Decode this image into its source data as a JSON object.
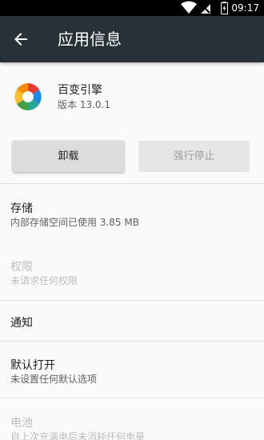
{
  "status_bar": {
    "time": "09:17",
    "icons": [
      "wifi-icon",
      "no-sim-icon",
      "battery-charging-icon"
    ]
  },
  "toolbar": {
    "title": "应用信息",
    "back_icon": "arrow-back-icon",
    "background": "#263238"
  },
  "app": {
    "name": "百变引擎",
    "version": "版本 13.0.1"
  },
  "buttons": {
    "uninstall": "卸载",
    "force_stop": "强行停止"
  },
  "settings": [
    {
      "title": "存储",
      "subtitle": "内部存储空间已使用 3.85 MB",
      "enabled": true
    },
    {
      "title": "权限",
      "subtitle": "未请求任何权限",
      "enabled": false
    },
    {
      "title": "通知",
      "subtitle": "",
      "enabled": true
    },
    {
      "title": "默认打开",
      "subtitle": "未设置任何默认选项",
      "enabled": true
    },
    {
      "title": "电池",
      "subtitle": "自上次充满电后未消耗任何电量",
      "enabled": false
    }
  ]
}
